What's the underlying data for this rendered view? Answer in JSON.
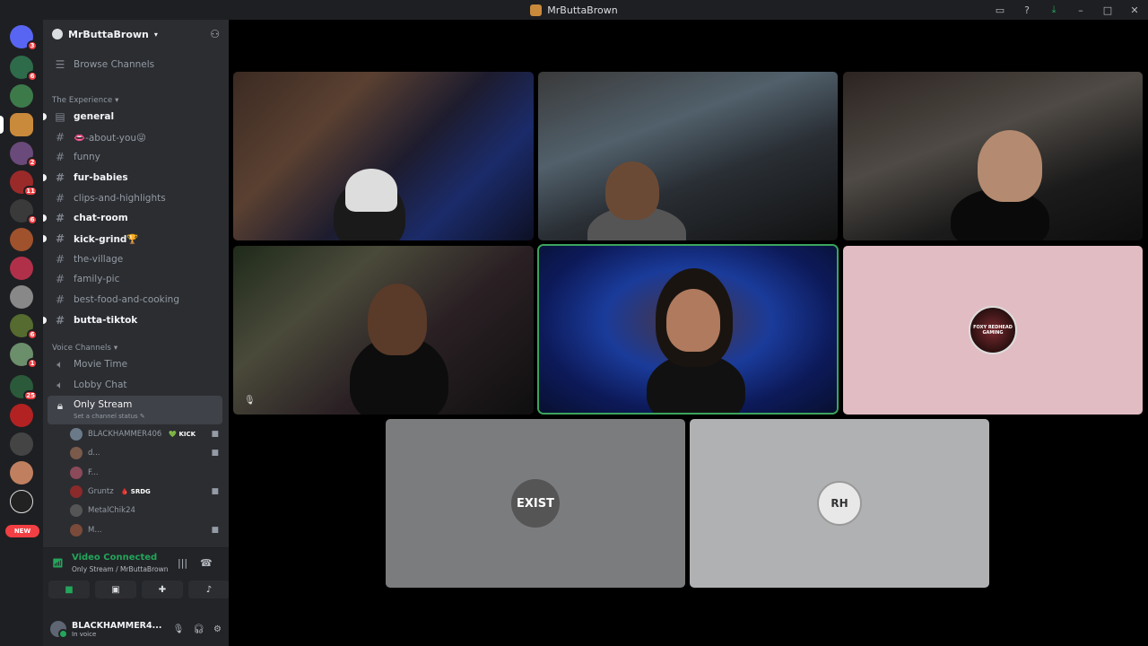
{
  "window": {
    "title": "MrButtaBrown"
  },
  "servers": {
    "badges": [
      "3",
      "6",
      "2",
      "11",
      "6",
      "6",
      "1",
      "25"
    ],
    "new_label": "NEW"
  },
  "guild": {
    "name": "MrButtaBrown",
    "browse_label": "Browse Channels"
  },
  "categories": {
    "experience": "The Experience",
    "voice": "Voice Channels"
  },
  "channels": [
    {
      "name": "general",
      "unread": true
    },
    {
      "name": "👄-about-you😜",
      "unread": false
    },
    {
      "name": "funny",
      "unread": false
    },
    {
      "name": "fur-babies",
      "unread": true
    },
    {
      "name": "clips-and-highlights",
      "unread": false
    },
    {
      "name": "chat-room",
      "unread": true
    },
    {
      "name": "kick-grind🏆",
      "unread": true
    },
    {
      "name": "the-village",
      "unread": false
    },
    {
      "name": "family-pic",
      "unread": false
    },
    {
      "name": "best-food-and-cooking",
      "unread": false
    },
    {
      "name": "butta-tiktok",
      "unread": true
    }
  ],
  "voice_channels": [
    {
      "name": "Movie Time"
    },
    {
      "name": "Lobby Chat"
    },
    {
      "name": "Only Stream",
      "status_placeholder": "Set a channel status"
    }
  ],
  "voice_users": [
    {
      "name": "BLACKHAMMER406",
      "tag": "💚 KICK",
      "camera": true,
      "color": "#6b7a88"
    },
    {
      "name": "d...",
      "tag": "",
      "camera": true,
      "color": "#7a5a4a"
    },
    {
      "name": "F...",
      "tag": "",
      "camera": false,
      "color": "#8a4a5a"
    },
    {
      "name": "Gruntz",
      "tag": "🩸 SRDG",
      "camera": true,
      "color": "#8a2a2a"
    },
    {
      "name": "MetalChik24",
      "tag": "",
      "camera": false,
      "color": "#555"
    },
    {
      "name": "M...",
      "tag": "",
      "camera": true,
      "color": "#7a4a3a"
    }
  ],
  "rtc": {
    "status": "Video Connected",
    "location": "Only Stream / MrButtaBrown"
  },
  "user_panel": {
    "username": "BLACKHAMMER4...",
    "status": "In voice"
  },
  "tiles": {
    "foxy_label": "FOXY REDHEAD GAMING",
    "exist_label": "EXIST",
    "rh_label": "RH"
  },
  "colors": {
    "accent_green": "#23a55a",
    "badge_red": "#f23f43",
    "tile_pink": "#e1bcc3",
    "tile_gray1": "#7b7c7e",
    "tile_gray2": "#b0b1b3"
  }
}
